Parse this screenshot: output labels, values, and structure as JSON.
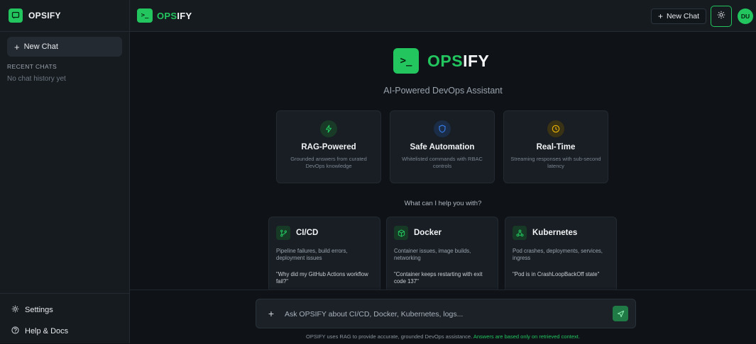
{
  "brand": {
    "part1": "OPS",
    "part2": "IFY",
    "full": "OPSIFY",
    "accent": "#22c55e"
  },
  "sidebar": {
    "title": "OPSIFY",
    "new_chat_label": "New Chat",
    "recent_label": "RECENT CHATS",
    "empty_history": "No chat history yet",
    "footer": {
      "settings": "Settings",
      "help": "Help & Docs"
    }
  },
  "topbar": {
    "new_chat_label": "New Chat",
    "theme_icon": "sun-icon",
    "avatar_initials": "DU"
  },
  "hero": {
    "badge_glyph": ">_",
    "subtitle": "AI-Powered DevOps Assistant"
  },
  "features": [
    {
      "icon": "bolt-icon",
      "color": "#22c55e",
      "title": "RAG-Powered",
      "desc": "Grounded answers from curated DevOps knowledge"
    },
    {
      "icon": "shield-icon",
      "color": "#3b82f6",
      "title": "Safe Automation",
      "desc": "Whitelisted commands with RBAC controls"
    },
    {
      "icon": "clock-icon",
      "color": "#eab308",
      "title": "Real-Time",
      "desc": "Streaming responses with sub-second latency"
    }
  ],
  "help_question": "What can I help you with?",
  "topics": [
    {
      "icon": "git-branch-icon",
      "title": "CI/CD",
      "desc": "Pipeline failures, build errors, deployment issues",
      "example": "\"Why did my GitHub Actions workflow fail?\""
    },
    {
      "icon": "package-icon",
      "title": "Docker",
      "desc": "Container issues, image builds, networking",
      "example": "\"Container keeps restarting with exit code 137\""
    },
    {
      "icon": "cluster-icon",
      "title": "Kubernetes",
      "desc": "Pod crashes, deployments, services, ingress",
      "example": "\"Pod is in CrashLoopBackOff state\""
    }
  ],
  "input": {
    "placeholder": "Ask OPSIFY about CI/CD, Docker, Kubernetes, logs...",
    "value": ""
  },
  "disclaimer": {
    "text": "OPSIFY uses RAG to provide accurate, grounded DevOps assistance.",
    "highlight": "Answers are based only on retrieved context."
  }
}
